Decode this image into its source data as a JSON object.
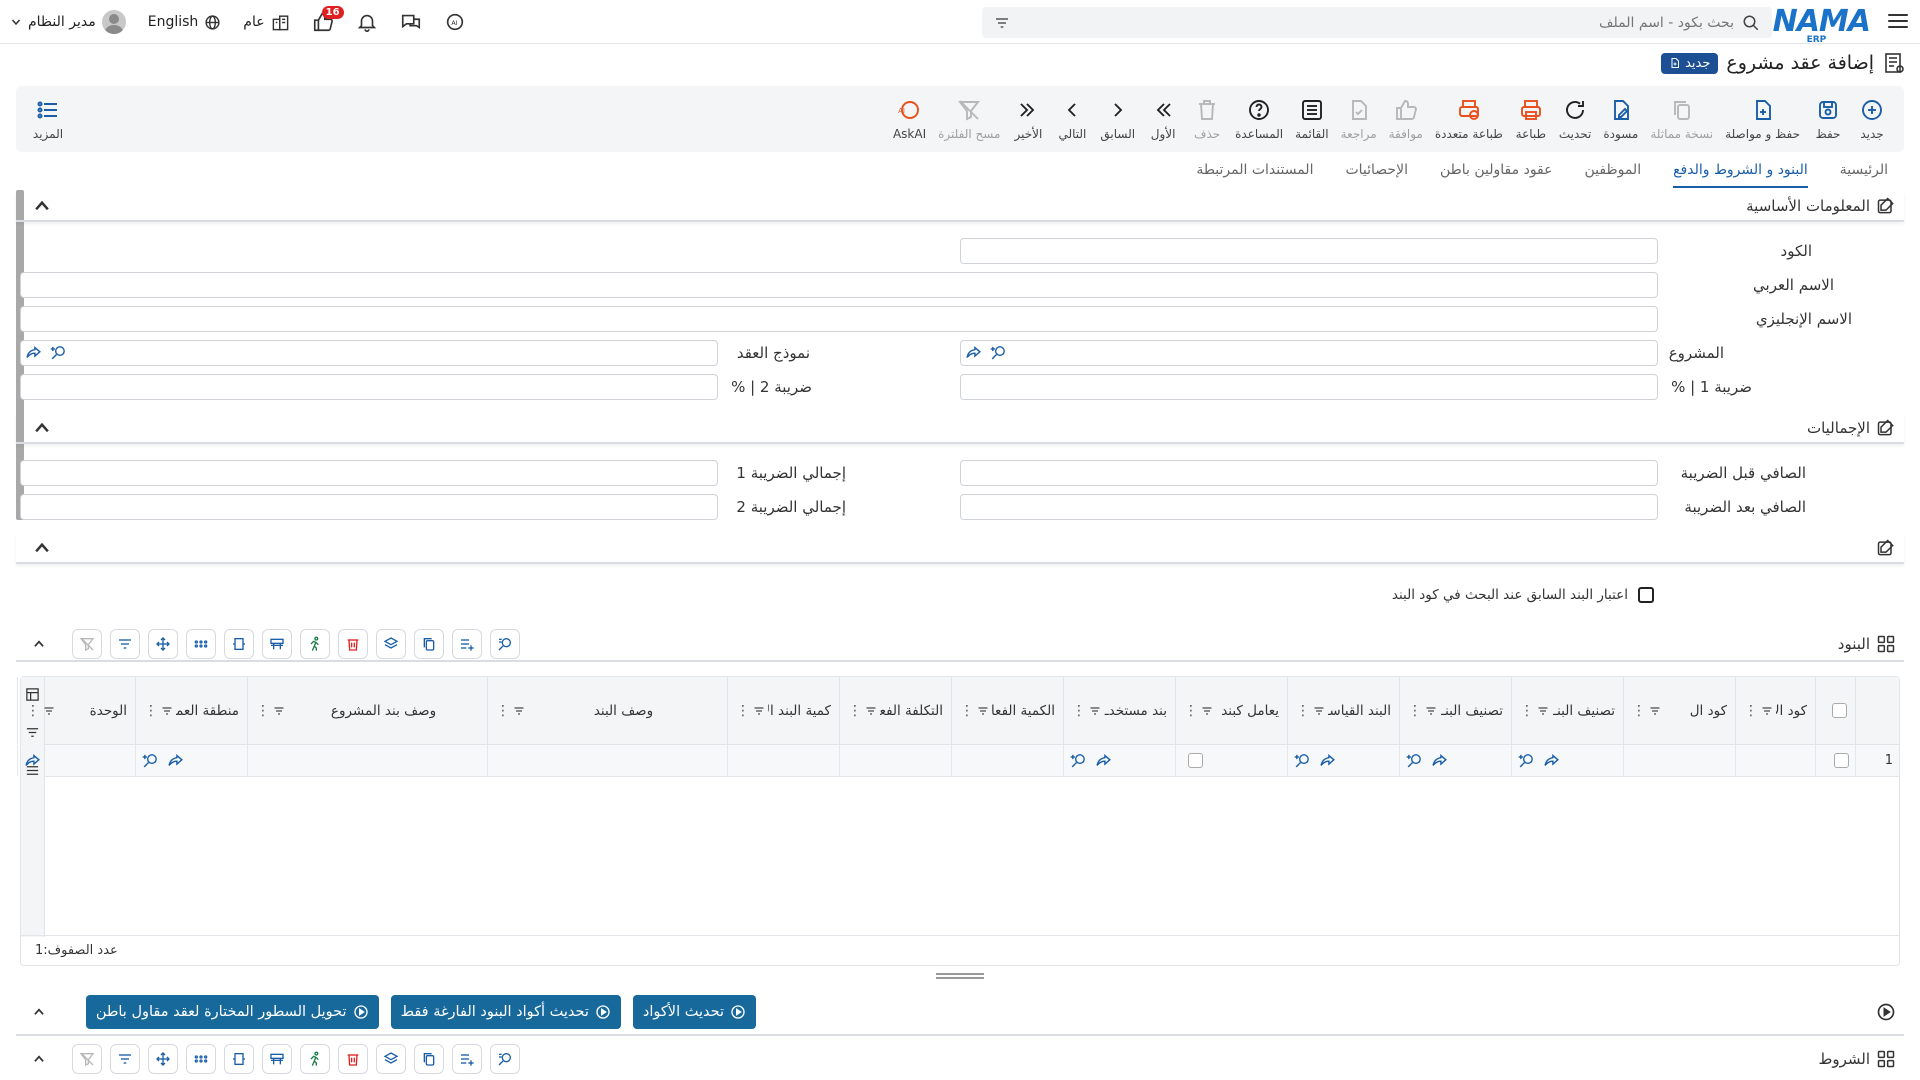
{
  "topbar": {
    "logo_text": "NAMA",
    "logo_sub": "ERP",
    "search_placeholder": "بحث بكود - اسم الملف",
    "language": "English",
    "general_label": "عام",
    "notifications_count": "16",
    "user_name": "مدير النظام"
  },
  "page": {
    "title": "إضافة عقد مشروع",
    "status_badge": "جديد"
  },
  "toolbar": {
    "buttons": [
      {
        "label": "جديد",
        "icon": "plus-circle-icon",
        "enabled": true
      },
      {
        "label": "حفظ",
        "icon": "save-icon",
        "enabled": true
      },
      {
        "label": "حفظ و مواصلة",
        "icon": "save-continue-icon",
        "enabled": true
      },
      {
        "label": "نسخة مماثلة",
        "icon": "copy-icon",
        "enabled": false
      },
      {
        "label": "مسودة",
        "icon": "draft-icon",
        "enabled": true
      },
      {
        "label": "تحديث",
        "icon": "refresh-icon",
        "enabled": true
      },
      {
        "label": "طباعة",
        "icon": "print-icon",
        "enabled": true
      },
      {
        "label": "طباعة متعددة",
        "icon": "multi-print-icon",
        "enabled": true
      },
      {
        "label": "موافقة",
        "icon": "thumbs-up-icon",
        "enabled": false
      },
      {
        "label": "مراجعة",
        "icon": "review-icon",
        "enabled": false
      },
      {
        "label": "القائمة",
        "icon": "list-icon",
        "enabled": true
      },
      {
        "label": "المساعدة",
        "icon": "help-icon",
        "enabled": true
      },
      {
        "label": "حذف",
        "icon": "trash-icon",
        "enabled": false
      },
      {
        "label": "الأول",
        "icon": "first-icon",
        "enabled": true
      },
      {
        "label": "السابق",
        "icon": "prev-icon",
        "enabled": true
      },
      {
        "label": "التالي",
        "icon": "next-icon",
        "enabled": true
      },
      {
        "label": "الأخير",
        "icon": "last-icon",
        "enabled": true
      },
      {
        "label": "مسح الفلترة",
        "icon": "clear-filter-icon",
        "enabled": false
      },
      {
        "label": "AskAI",
        "icon": "ask-ai-icon",
        "enabled": true
      }
    ],
    "more_label": "المزيد"
  },
  "tabs": [
    {
      "label": "الرئيسية",
      "active": false
    },
    {
      "label": "البنود و الشروط والدفع",
      "active": true
    },
    {
      "label": "الموظفين",
      "active": false
    },
    {
      "label": "عقود مقاولين باطن",
      "active": false
    },
    {
      "label": "الإحصائيات",
      "active": false
    },
    {
      "label": "المستندات المرتبطة",
      "active": false
    }
  ],
  "basic_info": {
    "title": "المعلومات الأساسية",
    "code_label": "الكود",
    "arabic_name_label": "الاسم العربي",
    "english_name_label": "الاسم الإنجليزي",
    "project_label": "المشروع",
    "contract_template_label": "نموذج العقد",
    "tax1_label": "ضريبة 1 | %",
    "tax2_label": "ضريبة 2 | %"
  },
  "totals": {
    "title": "الإجماليات",
    "net_before_tax_label": "الصافي قبل الضريبة",
    "tax1_total_label": "إجمالي الضريبة 1",
    "net_after_tax_label": "الصافي بعد الضريبة",
    "tax2_total_label": "إجمالي الضريبة 2"
  },
  "items_section": {
    "consider_prev_label": "اعتبار البند السابق عند البحث في كود البند",
    "title": "البنود",
    "columns": [
      "كود الا",
      "كود ال",
      "تصنيف البنـ",
      "تصنيف البنـ",
      "البند القياسـ",
      "يعامل كبند",
      "بند مستخدـ",
      "الكمية الفعاـ",
      "التكلفة الفعـ",
      "كمية البند الا",
      "وصف البند",
      "وصف بند المشروع",
      "منطقة العمـ",
      "الوحدة"
    ],
    "row_number": "1",
    "row_count_label": "عدد الصفوف:",
    "row_count": "1"
  },
  "actions": {
    "update_codes": "تحديث الأكواد",
    "update_empty_codes": "تحديث أكواد البنود الفارغة فقط",
    "convert_rows": "تحويل السطور المختارة لعقد مقاول باطن"
  },
  "terms_section": {
    "title": "الشروط"
  },
  "colors": {
    "accent": "#1a5ea8",
    "action_button": "#17689b",
    "badge_red": "#e02020",
    "print_orange": "#e8501e"
  }
}
